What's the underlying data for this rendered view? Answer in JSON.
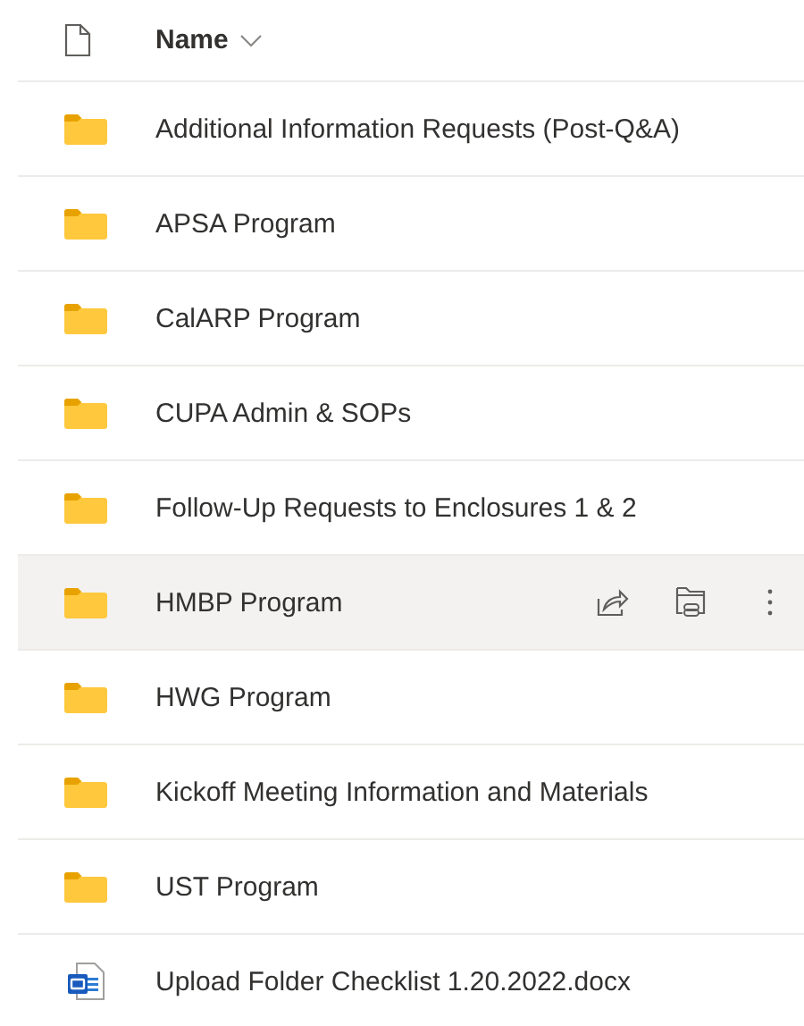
{
  "header": {
    "column": "Name"
  },
  "items": [
    {
      "kind": "folder",
      "name": "Additional Information Requests (Post-Q&A)",
      "hovered": false
    },
    {
      "kind": "folder",
      "name": "APSA Program",
      "hovered": false
    },
    {
      "kind": "folder",
      "name": "CalARP Program",
      "hovered": false
    },
    {
      "kind": "folder",
      "name": "CUPA Admin & SOPs",
      "hovered": false
    },
    {
      "kind": "folder",
      "name": "Follow-Up Requests to Enclosures 1 & 2",
      "hovered": false
    },
    {
      "kind": "folder",
      "name": "HMBP Program",
      "hovered": true
    },
    {
      "kind": "folder",
      "name": "HWG Program",
      "hovered": false
    },
    {
      "kind": "folder",
      "name": "Kickoff Meeting Information and Materials",
      "hovered": false
    },
    {
      "kind": "folder",
      "name": "UST Program",
      "hovered": false
    },
    {
      "kind": "word",
      "name": "Upload Folder Checklist 1.20.2022.docx",
      "hovered": false
    }
  ]
}
